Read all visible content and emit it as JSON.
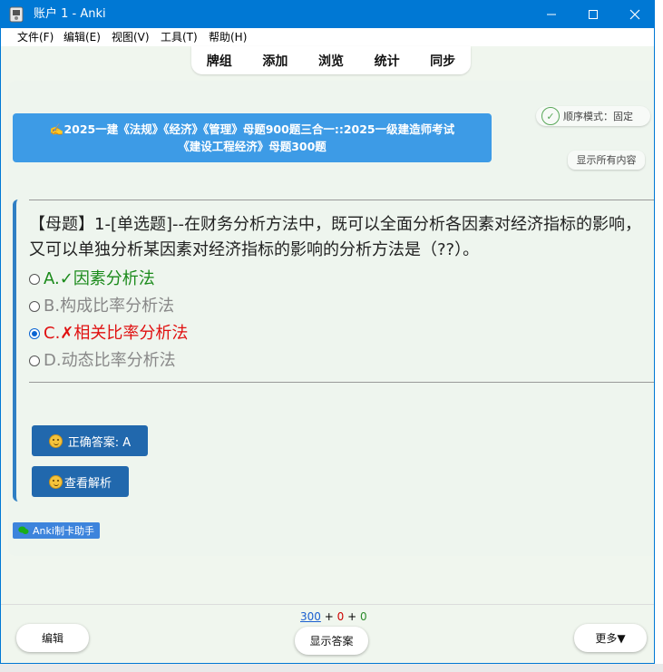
{
  "window": {
    "title": "账户 1 - Anki"
  },
  "menu": {
    "items": [
      "文件(F)",
      "编辑(E)",
      "视图(V)",
      "工具(T)",
      "帮助(H)"
    ]
  },
  "toolbar": {
    "items": [
      "牌组",
      "添加",
      "浏览",
      "统计",
      "同步"
    ]
  },
  "deck": {
    "line1": "✍️2025一建《法规》《经济》《管理》母题900题三合一::2025一级建造师考试",
    "line2": "《建设工程经济》母题300题"
  },
  "order_mode": {
    "label": "顺序模式：固定"
  },
  "show_all": {
    "label": "显示所有内容"
  },
  "card": {
    "question": "【母题】1-[单选题]--在财务分析方法中，既可以全面分析各因素对经济指标的影响，又可以单独分析某因素对经济指标的影响的分析方法是（??）。",
    "options": [
      {
        "letter": "A.",
        "mark": "✓",
        "text": "因素分析法",
        "color": "#1a8a1a"
      },
      {
        "letter": "B.",
        "mark": "",
        "text": "构成比率分析法",
        "color": "#888888"
      },
      {
        "letter": "C.",
        "mark": "✗",
        "text": "相关比率分析法",
        "color": "#e01010"
      },
      {
        "letter": "D.",
        "mark": "",
        "text": "动态比率分析法",
        "color": "#888888"
      }
    ],
    "correct_answer_label": "正确答案: A",
    "explain_label": "查看解析"
  },
  "helper_tag": {
    "label": "Anki制卡助手"
  },
  "bottom": {
    "count_new": "300",
    "plus1": "+",
    "count_learn": "0",
    "plus2": "+",
    "count_review": "0",
    "edit_label": "编辑",
    "show_answer_label": "显示答案",
    "more_label": "更多▼"
  }
}
